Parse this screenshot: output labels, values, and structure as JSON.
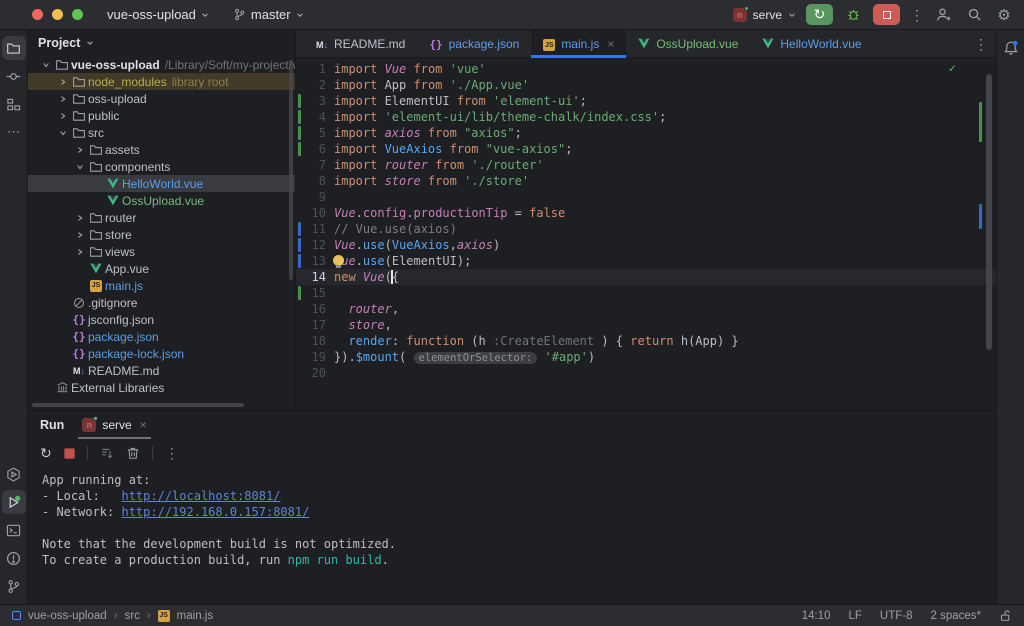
{
  "titlebar": {
    "project": "vue-oss-upload",
    "branch": "master",
    "run_config": "serve"
  },
  "tabs": [
    {
      "label": "README.md",
      "icon": "md",
      "state": "normal"
    },
    {
      "label": "package.json",
      "icon": "json",
      "state": "modified"
    },
    {
      "label": "main.js",
      "icon": "js",
      "state": "modified",
      "active": true,
      "close": "×"
    },
    {
      "label": "OssUpload.vue",
      "icon": "vue",
      "state": "added"
    },
    {
      "label": "HelloWorld.vue",
      "icon": "vue",
      "state": "modified"
    }
  ],
  "project_panel": {
    "header": "Project",
    "items": [
      {
        "depth": 0,
        "chevron": "open",
        "icon": "folder",
        "label": "vue-oss-upload",
        "bold": true,
        "suffix": "/Library/Soft/my-project/vue/vue-os"
      },
      {
        "depth": 1,
        "chevron": "closed",
        "icon": "folder",
        "label": "node_modules",
        "state": "excluded",
        "suffix": "library root",
        "row": "excluded"
      },
      {
        "depth": 1,
        "chevron": "closed",
        "icon": "folder",
        "label": "oss-upload"
      },
      {
        "depth": 1,
        "chevron": "closed",
        "icon": "folder",
        "label": "public"
      },
      {
        "depth": 1,
        "chevron": "open",
        "icon": "folder",
        "label": "src"
      },
      {
        "depth": 2,
        "chevron": "closed",
        "icon": "folder",
        "label": "assets"
      },
      {
        "depth": 2,
        "chevron": "open",
        "icon": "folder",
        "label": "components"
      },
      {
        "depth": 3,
        "icon": "vue",
        "label": "HelloWorld.vue",
        "state": "modified",
        "row": "selected"
      },
      {
        "depth": 3,
        "icon": "vue",
        "label": "OssUpload.vue",
        "state": "added"
      },
      {
        "depth": 2,
        "chevron": "closed",
        "icon": "folder",
        "label": "router"
      },
      {
        "depth": 2,
        "chevron": "closed",
        "icon": "folder",
        "label": "store"
      },
      {
        "depth": 2,
        "chevron": "closed",
        "icon": "folder",
        "label": "views"
      },
      {
        "depth": 2,
        "icon": "vue",
        "label": "App.vue"
      },
      {
        "depth": 2,
        "icon": "js",
        "label": "main.js",
        "state": "modified"
      },
      {
        "depth": 1,
        "icon": "ignore",
        "label": ".gitignore"
      },
      {
        "depth": 1,
        "icon": "json",
        "label": "jsconfig.json"
      },
      {
        "depth": 1,
        "icon": "json",
        "label": "package.json",
        "state": "modified"
      },
      {
        "depth": 1,
        "icon": "json",
        "label": "package-lock.json",
        "state": "modified"
      },
      {
        "depth": 1,
        "icon": "md",
        "label": "README.md"
      },
      {
        "depth": 0,
        "icon": "lib",
        "label": "External Libraries"
      }
    ]
  },
  "editor": {
    "lines": [
      {
        "num": 1,
        "segments": [
          {
            "c": "kw",
            "t": "import "
          },
          {
            "c": "gv",
            "t": "Vue"
          },
          {
            "c": "kw",
            "t": " from "
          },
          {
            "c": "str",
            "t": "'vue'"
          }
        ]
      },
      {
        "num": 2,
        "segments": [
          {
            "c": "kw",
            "t": "import "
          },
          {
            "c": "id",
            "t": "App"
          },
          {
            "c": "kw",
            "t": " from "
          },
          {
            "c": "str",
            "t": "'./App.vue'"
          }
        ]
      },
      {
        "num": 3,
        "gutter": "green",
        "segments": [
          {
            "c": "kw",
            "t": "import "
          },
          {
            "c": "id",
            "t": "ElementUI"
          },
          {
            "c": "kw",
            "t": " from "
          },
          {
            "c": "str",
            "t": "'element-ui'"
          },
          {
            "c": "id",
            "t": ";"
          }
        ]
      },
      {
        "num": 4,
        "gutter": "green",
        "segments": [
          {
            "c": "kw",
            "t": "import "
          },
          {
            "c": "str",
            "t": "'element-ui/lib/theme-chalk/index.css'"
          },
          {
            "c": "id",
            "t": ";"
          }
        ]
      },
      {
        "num": 5,
        "gutter": "green",
        "segments": [
          {
            "c": "kw",
            "t": "import "
          },
          {
            "c": "gv",
            "t": "axios"
          },
          {
            "c": "kw",
            "t": " from "
          },
          {
            "c": "str",
            "t": "\"axios\""
          },
          {
            "c": "id",
            "t": ";"
          }
        ]
      },
      {
        "num": 6,
        "gutter": "green",
        "segments": [
          {
            "c": "kw",
            "t": "import "
          },
          {
            "c": "fn",
            "t": "VueAxios"
          },
          {
            "c": "kw",
            "t": " from "
          },
          {
            "c": "str",
            "t": "\"vue-axios\""
          },
          {
            "c": "id",
            "t": ";"
          }
        ]
      },
      {
        "num": 7,
        "segments": [
          {
            "c": "kw",
            "t": "import "
          },
          {
            "c": "gv",
            "t": "router"
          },
          {
            "c": "kw",
            "t": " from "
          },
          {
            "c": "str",
            "t": "'./router'"
          }
        ]
      },
      {
        "num": 8,
        "segments": [
          {
            "c": "kw",
            "t": "import "
          },
          {
            "c": "gv",
            "t": "store"
          },
          {
            "c": "kw",
            "t": " from "
          },
          {
            "c": "str",
            "t": "'./store'"
          }
        ]
      },
      {
        "num": 9,
        "segments": []
      },
      {
        "num": 10,
        "segments": [
          {
            "c": "gv",
            "t": "Vue"
          },
          {
            "c": "id",
            "t": "."
          },
          {
            "c": "pr",
            "t": "config"
          },
          {
            "c": "id",
            "t": "."
          },
          {
            "c": "pr",
            "t": "productionTip"
          },
          {
            "c": "id",
            "t": " = "
          },
          {
            "c": "kw",
            "t": "false"
          }
        ]
      },
      {
        "num": 11,
        "gutter": "blue",
        "segments": [
          {
            "c": "cm",
            "t": "// Vue.use(axios)"
          }
        ]
      },
      {
        "num": 12,
        "gutter": "blue",
        "segments": [
          {
            "c": "gv",
            "t": "Vue"
          },
          {
            "c": "id",
            "t": "."
          },
          {
            "c": "fn",
            "t": "use"
          },
          {
            "c": "id",
            "t": "("
          },
          {
            "c": "fn",
            "t": "VueAxios"
          },
          {
            "c": "id",
            "t": ","
          },
          {
            "c": "gv",
            "t": "axios"
          },
          {
            "c": "id",
            "t": ")"
          }
        ]
      },
      {
        "num": 13,
        "gutter": "blue",
        "bulb": true,
        "segments": [
          {
            "c": "gv",
            "t": "Vue"
          },
          {
            "c": "id",
            "t": "."
          },
          {
            "c": "fn",
            "t": "use"
          },
          {
            "c": "id",
            "t": "("
          },
          {
            "c": "id",
            "t": "ElementUI"
          },
          {
            "c": "id",
            "t": ");"
          }
        ]
      },
      {
        "num": 14,
        "current": true,
        "caret": true,
        "segments": [
          {
            "c": "kw",
            "t": "new "
          },
          {
            "c": "gv",
            "t": "Vue"
          },
          {
            "c": "id",
            "t": "({"
          }
        ]
      },
      {
        "num": 15,
        "gutter": "green",
        "segments": []
      },
      {
        "num": 16,
        "segments": [
          {
            "c": "id",
            "t": "  "
          },
          {
            "c": "gv",
            "t": "router"
          },
          {
            "c": "id",
            "t": ","
          }
        ]
      },
      {
        "num": 17,
        "segments": [
          {
            "c": "id",
            "t": "  "
          },
          {
            "c": "gv",
            "t": "store"
          },
          {
            "c": "id",
            "t": ","
          }
        ]
      },
      {
        "num": 18,
        "segments": [
          {
            "c": "id",
            "t": "  "
          },
          {
            "c": "fn",
            "t": "render"
          },
          {
            "c": "id",
            "t": ": "
          },
          {
            "c": "kw",
            "t": "function "
          },
          {
            "c": "id",
            "t": "(h "
          },
          {
            "c": "in",
            "t": ":CreateElement "
          },
          {
            "c": "id",
            "t": ") { "
          },
          {
            "c": "kw",
            "t": "return"
          },
          {
            "c": "id",
            "t": " h(App) }"
          }
        ]
      },
      {
        "num": 19,
        "segments": [
          {
            "c": "id",
            "t": "})."
          },
          {
            "c": "fn",
            "t": "$mount"
          },
          {
            "c": "id",
            "t": "( "
          },
          {
            "c": "pill",
            "t": "elementOrSelector:"
          },
          {
            "c": "id",
            "t": " "
          },
          {
            "c": "str",
            "t": "'#app'"
          },
          {
            "c": "id",
            "t": ")"
          }
        ]
      },
      {
        "num": 20,
        "segments": []
      }
    ]
  },
  "run_panel": {
    "title": "Run",
    "tab_label": "serve",
    "tab_close": "×",
    "console": [
      [
        {
          "t": "App running at:"
        }
      ],
      [
        {
          "t": "- Local:   "
        },
        {
          "t": "http://localhost:8081/",
          "c": "link"
        }
      ],
      [
        {
          "t": "- Network: "
        },
        {
          "t": "http://192.168.0.157:8081/",
          "c": "link"
        }
      ],
      [
        {
          "t": ""
        }
      ],
      [
        {
          "t": "Note that the development build is not optimized."
        }
      ],
      [
        {
          "t": "To create a production build, run "
        },
        {
          "t": "npm run build",
          "c": "cyan"
        },
        {
          "t": "."
        }
      ]
    ]
  },
  "statusbar": {
    "breadcrumb": [
      "vue-oss-upload",
      "src",
      "main.js"
    ],
    "right": [
      "14:10",
      "LF",
      "UTF-8",
      "2 spaces*"
    ]
  },
  "colors": {
    "accent": "#3574f0",
    "modified": "#5e9de6",
    "added": "#73bd79",
    "excluded": "#b3ae4d",
    "link": "#5c85d6",
    "string": "#6aab73",
    "keyword": "#cf8e6d"
  }
}
